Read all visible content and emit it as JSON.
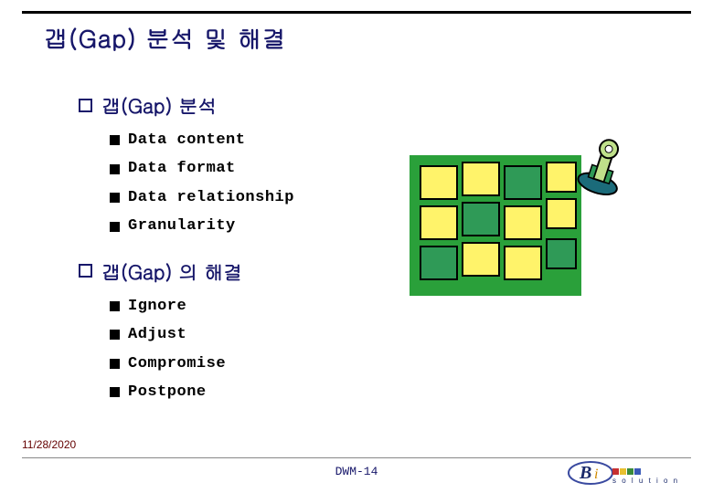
{
  "title": "갭(Gap) 분석 및 해결",
  "sections": [
    {
      "heading": "갭(Gap) 분석",
      "items": [
        "Data content",
        "Data format",
        "Data relationship",
        "Granularity"
      ]
    },
    {
      "heading": "갭(Gap) 의 해결",
      "items": [
        "Ignore",
        "Adjust",
        "Compromise",
        "Postpone"
      ]
    }
  ],
  "footer": {
    "date": "11/28/2020",
    "label": "DWM-14"
  },
  "logo": {
    "text_main": "B",
    "text_sub": "i",
    "text_tag": "solution"
  }
}
